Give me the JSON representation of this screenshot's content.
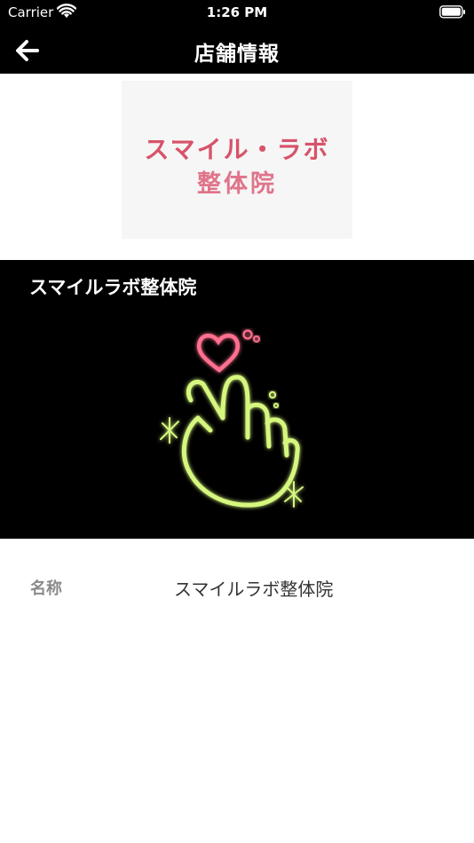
{
  "status_bar": {
    "carrier": "Carrier",
    "time": "1:26 PM"
  },
  "nav": {
    "title": "店舗情報",
    "back_icon": "arrow-left-icon"
  },
  "logo": {
    "line1": "スマイル・ラボ",
    "line2": "整体院"
  },
  "hero": {
    "title": "スマイルラボ整体院",
    "art_icon": "finger-heart-icon"
  },
  "info": {
    "name_label": "名称",
    "name_value": "スマイルラボ整体院"
  },
  "colors": {
    "bar_bg": "#000000",
    "logo_pink": "#d7536a",
    "neon_green": "#d6f77e",
    "neon_pink": "#ff6f8f"
  }
}
